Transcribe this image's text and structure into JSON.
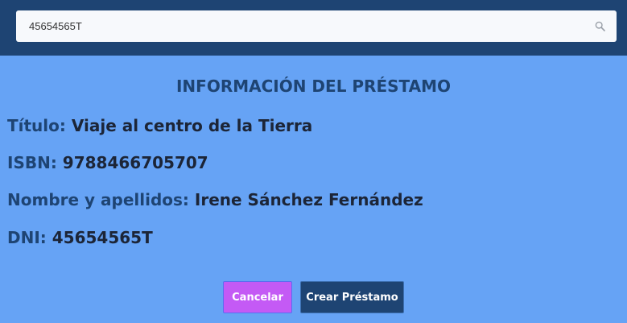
{
  "search": {
    "value": "45654565T",
    "icon": "search-icon"
  },
  "loan": {
    "heading": "INFORMACIÓN DEL PRÉSTAMO",
    "fields": [
      {
        "label": "Título:",
        "value": "Viaje al centro de la Tierra"
      },
      {
        "label": "ISBN:",
        "value": "9788466705707"
      },
      {
        "label": "Nombre y apellidos:",
        "value": "Irene Sánchez Fernández"
      },
      {
        "label": "DNI:",
        "value": "45654565T"
      }
    ]
  },
  "actions": {
    "cancel_label": "Cancelar",
    "create_label": "Crear Préstamo"
  },
  "colors": {
    "header_bg": "#1e4473",
    "page_bg": "#66a3f5",
    "cancel_bg": "#c45af5",
    "create_bg": "#1e4473"
  }
}
